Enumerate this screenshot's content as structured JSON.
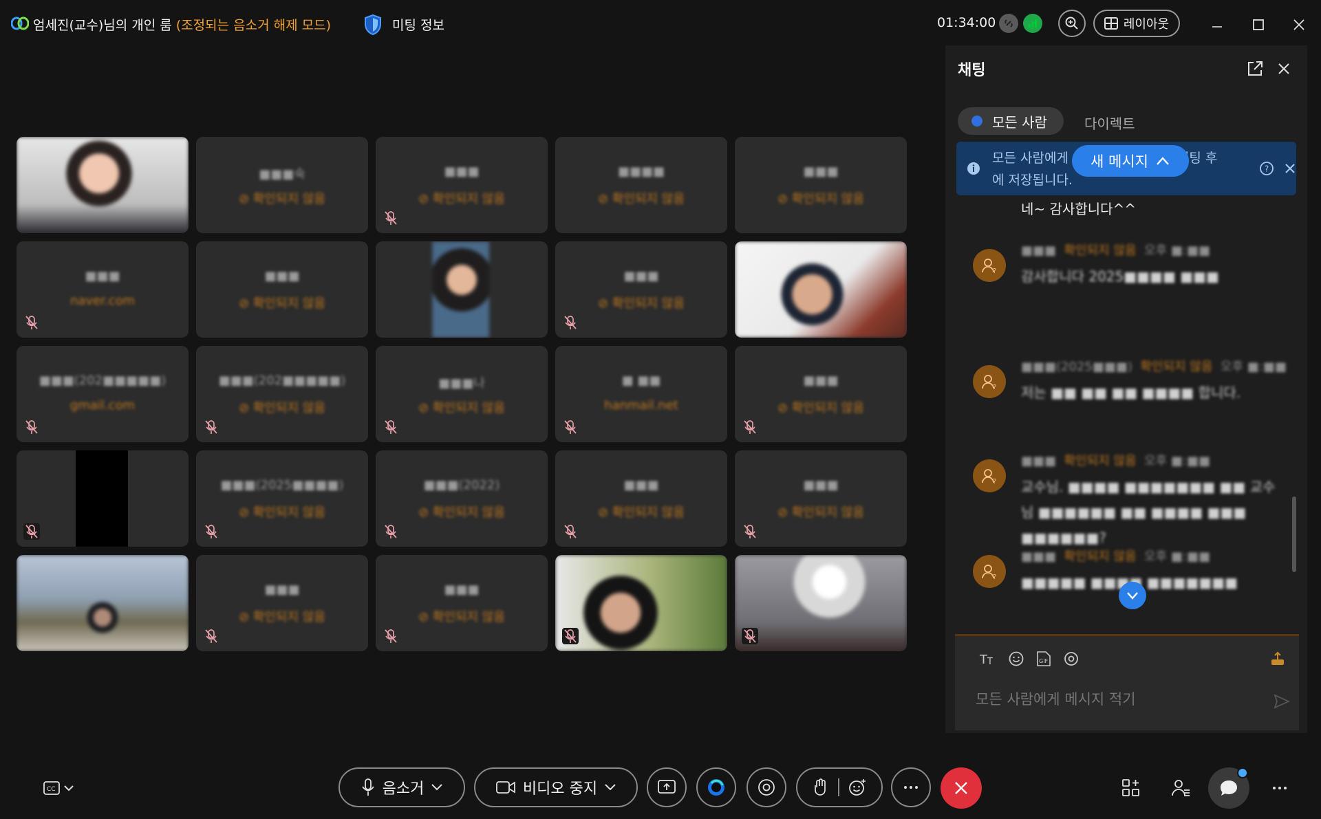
{
  "title_bar": {
    "room_name": "엄세진(교수)님의 개인 룸",
    "room_mode": "(조정되는 음소거 해제 모드)",
    "meeting_info": "미팅 정보",
    "timer": "01:34:00",
    "layout_label": "레이아웃"
  },
  "grid": {
    "tiles": [
      {
        "kind": "video",
        "name": "",
        "sub": "",
        "mute": false
      },
      {
        "kind": "name",
        "name": "■■■숙",
        "sub": "⊘ 확인되지 않음",
        "mute": false
      },
      {
        "kind": "name",
        "name": "■■■",
        "sub": "⊘ 확인되지 않음",
        "mute": true
      },
      {
        "kind": "name",
        "name": "■■■■",
        "sub": "⊘ 확인되지 않음",
        "mute": false
      },
      {
        "kind": "name",
        "name": "■■■",
        "sub": "⊘ 확인되지 않음",
        "mute": false
      },
      {
        "kind": "name",
        "name": "■■■",
        "sub": "naver.com",
        "mute": true
      },
      {
        "kind": "name",
        "name": "■■■",
        "sub": "⊘ 확인되지 않음",
        "mute": false
      },
      {
        "kind": "video",
        "name": "",
        "sub": "",
        "mute": false
      },
      {
        "kind": "name",
        "name": "■■■",
        "sub": "⊘ 확인되지 않음",
        "mute": true
      },
      {
        "kind": "video",
        "name": "",
        "sub": "",
        "mute": false
      },
      {
        "kind": "name",
        "name": "■■■(202■■■■■)",
        "sub": "gmail.com",
        "mute": true
      },
      {
        "kind": "name",
        "name": "■■■(202■■■■■)",
        "sub": "⊘ 확인되지 않음",
        "mute": true
      },
      {
        "kind": "name",
        "name": "■■■나",
        "sub": "⊘ 확인되지 않음",
        "mute": true
      },
      {
        "kind": "name",
        "name": "■ ■■",
        "sub": "hanmail.net",
        "mute": true
      },
      {
        "kind": "name",
        "name": "■■■",
        "sub": "⊘ 확인되지 않음",
        "mute": true
      },
      {
        "kind": "black",
        "name": "",
        "sub": "",
        "mute": true
      },
      {
        "kind": "name",
        "name": "■■■(2025■■■■)",
        "sub": "⊘ 확인되지 않음",
        "mute": true
      },
      {
        "kind": "name",
        "name": "■■■(2022)",
        "sub": "⊘ 확인되지 않음",
        "mute": true
      },
      {
        "kind": "name",
        "name": "■■■",
        "sub": "⊘ 확인되지 않음",
        "mute": true
      },
      {
        "kind": "name",
        "name": "■■■",
        "sub": "⊘ 확인되지 않음",
        "mute": true
      },
      {
        "kind": "video",
        "name": "",
        "sub": "",
        "mute": false
      },
      {
        "kind": "name",
        "name": "■■■",
        "sub": "⊘ 확인되지 않음",
        "mute": true
      },
      {
        "kind": "name",
        "name": "■■■",
        "sub": "⊘ 확인되지 않음",
        "mute": true
      },
      {
        "kind": "video",
        "name": "",
        "sub": "",
        "mute": true
      },
      {
        "kind": "video",
        "name": "",
        "sub": "",
        "mute": true
      }
    ]
  },
  "chat": {
    "title": "채팅",
    "tabs": {
      "all": "모든 사람",
      "direct": "다이렉트"
    },
    "notice": "모든 사람에게 보내지는 메시지는 미팅 후에 저장됩니다.",
    "new_message": "새 메시지",
    "plain_message": "네~ 감사합니다^^",
    "messages": [
      {
        "sender": "■■■",
        "status": "확인되지 않음",
        "time": "오후 ■:■■",
        "text": "감사합니다 2025■■■■ ■■■"
      },
      {
        "sender": "■■■(2025■■■)",
        "status": "확인되지 않음",
        "time": "오후 ■:■■",
        "text": "저는 ■■ ■■ ■■ ■■■■ 합니다."
      },
      {
        "sender": "■■■",
        "status": "확인되지 않음",
        "time": "오후 ■:■■",
        "text": "교수님. ■■■■ ■■■■■■■ ■■ 교수님 ■■■■■■ ■■ ■■■■ ■■■ ■■■■■■?"
      },
      {
        "sender": "■■■",
        "status": "확인되지 않음",
        "time": "오후 ■:■■",
        "text": "■■■■■ ■■■■ ■■■■■■■"
      }
    ],
    "input_placeholder": "모든 사람에게 메시지 적기"
  },
  "bottom_bar": {
    "mute_label": "음소거",
    "video_label": "비디오 중지"
  },
  "colors": {
    "accent_orange": "#f0a030",
    "end_call_red": "#e0303b",
    "brand_blue": "#2a7fe8",
    "notice_bg": "#163a66"
  }
}
